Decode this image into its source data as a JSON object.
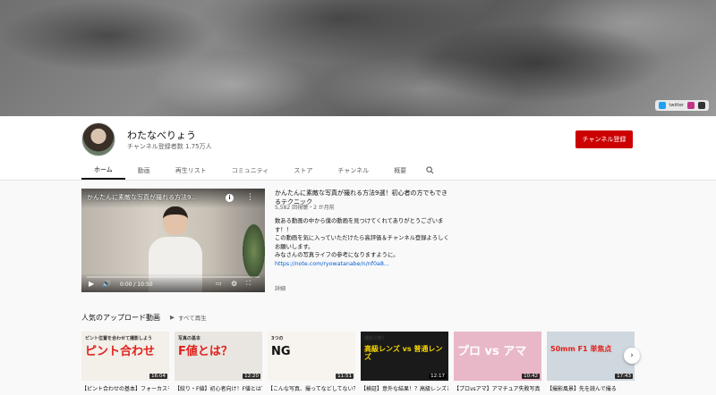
{
  "banner": {
    "link_text": "twitter"
  },
  "channel": {
    "name": "わたなべりょう",
    "subscribers": "チャンネル登録者数 1.75万人",
    "subscribe_label": "チャンネル登録"
  },
  "tabs": [
    "ホーム",
    "動画",
    "再生リスト",
    "コミュニティ",
    "ストア",
    "チャンネル",
    "概要"
  ],
  "featured": {
    "video_title": "かんたんに素敵な写真が撮れる方法9...",
    "time": "0:00 / 10:50",
    "desc_title": "かんたんに素敵な写真が撮れる方法9選！初心者の方でもできるテクニック",
    "meta": "5,582 回視聴・2 か月前",
    "body_lines": [
      "数ある動画の中から僕の動画を見つけてくれてありがとうございます！！",
      "この動画を気に入っていただけたら高評価＆チャンネル登録よろしくお願いします。",
      "みなさんの写真ライフの参考になりますように。"
    ],
    "link": "https://note.com/ryowatanabe/n/nf0a8...",
    "more": "詳細"
  },
  "shelf": {
    "title": "人気のアップロード動画",
    "play_all": "すべて再生",
    "videos": [
      {
        "title": "【ピント合わせの基本】フォーカスモード",
        "duration": "16:04",
        "caption": "ピント合わせ",
        "subcaption": "ピント位置を合わせて撮影しよう",
        "bg": "#f3efe9",
        "fg": "#e0201b"
      },
      {
        "title": "【絞り・F値】初心者向け！F値とは？",
        "duration": "12:20",
        "caption": "F値とは？",
        "subcaption": "写真の基本",
        "bg": "#e9e6e1",
        "fg": "#e0201b"
      },
      {
        "title": "【こんな写真、撮ってなどしてない？】",
        "duration": "11:51",
        "caption": "NG",
        "subcaption": "3つの",
        "bg": "#f7f4ef",
        "fg": "#111111"
      },
      {
        "title": "【検証】意外な結果！？高級レンズと普通レンズ",
        "duration": "12:17",
        "caption": "高級レンズ vs 普通レンズ",
        "subcaption": "撮影比較！",
        "bg": "#1a1a1a",
        "fg": "#f5d400"
      },
      {
        "title": "【プロvsアマ】アマチュア失敗写真",
        "duration": "10:42",
        "caption": "プロ vs アマ",
        "subcaption": "",
        "bg": "#e8b8c8",
        "fg": "#ffffff"
      },
      {
        "title": "【撮影風景】先を読んで撮る",
        "duration": "17:43",
        "caption": "50mm F1 単焦点",
        "subcaption": "",
        "bg": "#cfd7df",
        "fg": "#e0201b"
      }
    ]
  },
  "colors": {
    "subscribe": "#cc0000",
    "link": "#065fd4",
    "text_secondary": "#606060"
  }
}
